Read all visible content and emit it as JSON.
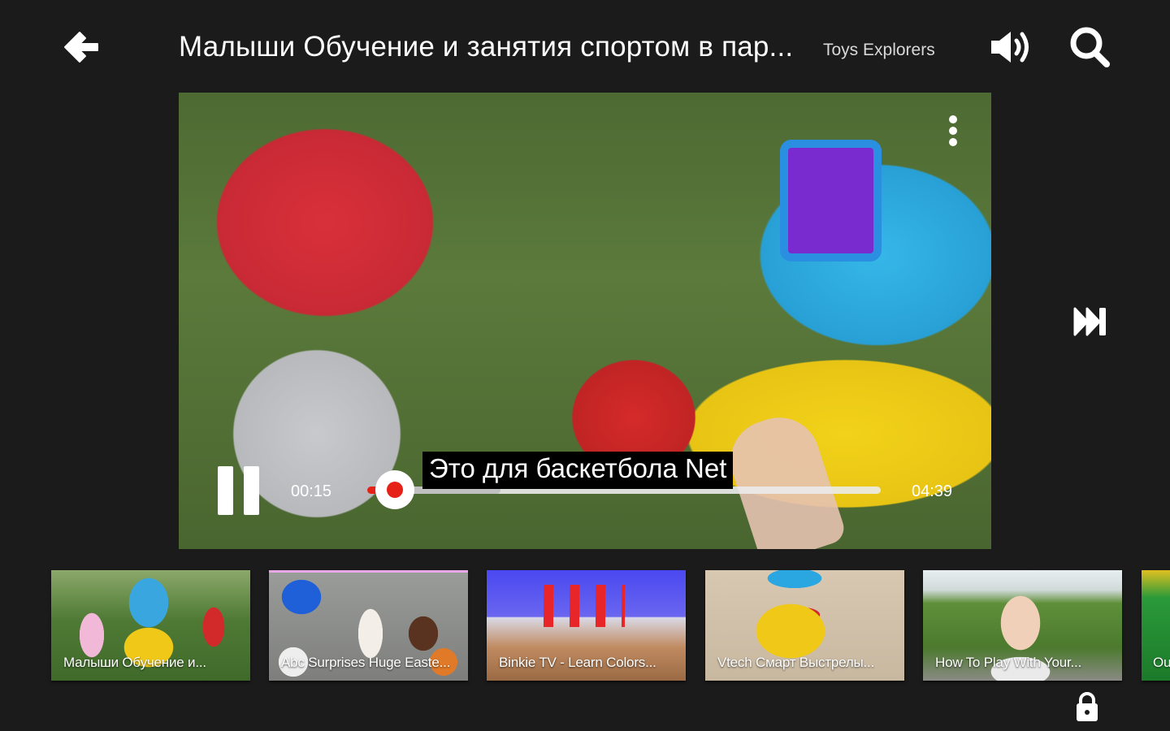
{
  "header": {
    "title": "Малыши Обучение и занятия спортом в пар...",
    "channel": "Toys Explorers",
    "icons": {
      "back": "arrow-left-icon",
      "volume": "volume-up-icon",
      "search": "search-icon"
    }
  },
  "player": {
    "caption": "Это для баскетбола Net",
    "current_time": "00:15",
    "total_time": "04:39",
    "progress_fraction": 0.054,
    "buffered_fraction": 0.26,
    "state": "playing",
    "icons": {
      "pause": "pause-icon",
      "more": "more-vertical-icon",
      "next": "skip-next-icon"
    }
  },
  "lock_icon": "lock-icon",
  "accent_color": "#e62117",
  "up_next": [
    {
      "title": "Малыши Обучение и...",
      "selected": true
    },
    {
      "title": "Abc Surprises Huge Easte...",
      "selected": false
    },
    {
      "title": "Binkie TV - Learn Colors...",
      "selected": false
    },
    {
      "title": "Vtech Смарт Выстрелы...",
      "selected": false
    },
    {
      "title": "How To Play With Your...",
      "selected": false
    },
    {
      "title": "Ou...",
      "selected": false
    }
  ]
}
